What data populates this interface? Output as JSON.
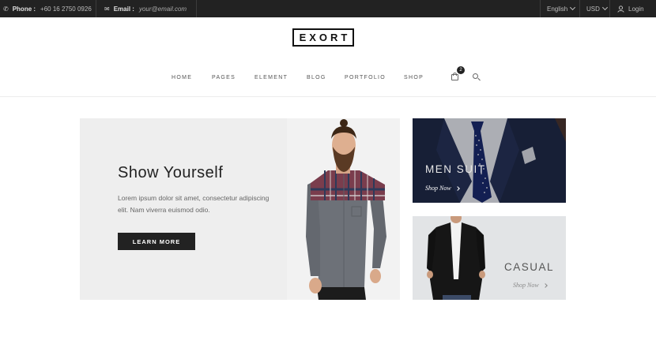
{
  "topbar": {
    "phone_label": "Phone :",
    "phone_value": "+60 16 2750 0926",
    "email_label": "Email :",
    "email_value": "your@email.com",
    "language": "English",
    "currency": "USD",
    "login": "Login"
  },
  "header": {
    "logo": "EXORT",
    "nav": [
      "HOME",
      "PAGES",
      "ELEMENT",
      "BLOG",
      "PORTFOLIO",
      "SHOP"
    ],
    "cart_count": "2"
  },
  "hero": {
    "title": "Show Yourself",
    "description": "Lorem ipsum dolor sit amet, consectetur adipiscing elit. Nam viverra euismod odio.",
    "button": "LEARN MORE"
  },
  "promos": {
    "men": {
      "title": "MEN SUIT",
      "link": "Shop Now"
    },
    "casual": {
      "title": "CASUAL",
      "link": "Shop Now"
    }
  },
  "colors": {
    "topbar_bg": "#222222",
    "hero_bg": "#eeeeee",
    "button_bg": "#222222",
    "accent_text": "#222222"
  }
}
